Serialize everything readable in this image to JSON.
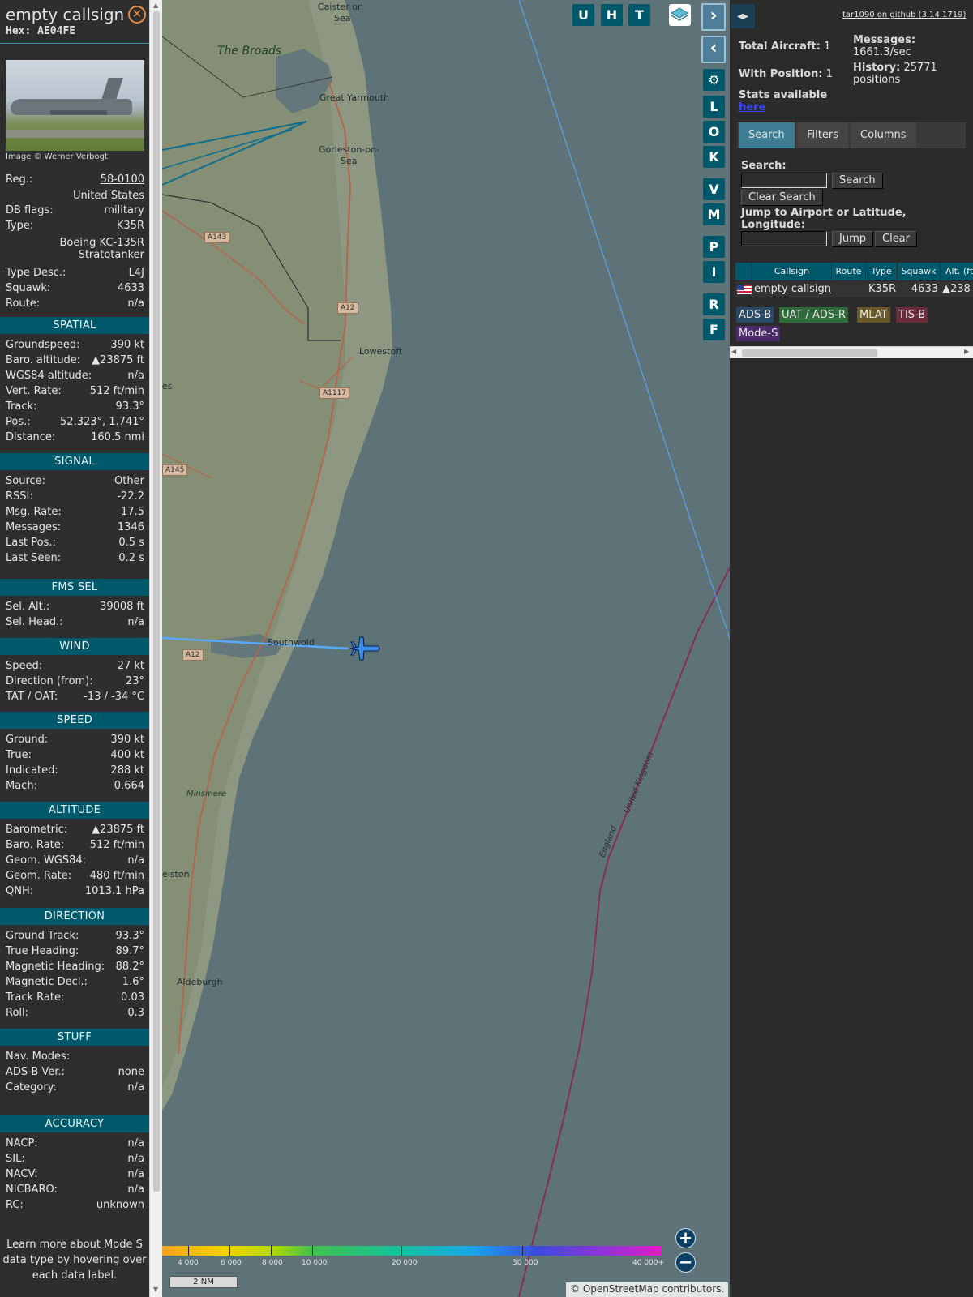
{
  "aircraft": {
    "callsign": "empty callsign",
    "hex_label": "Hex:",
    "hex": "AE04FE",
    "image_credit": "Image © Werner Verbogt",
    "reg_label": "Reg.:",
    "reg": "58-0100",
    "country": "United States",
    "db_flags_label": "DB flags:",
    "db_flags": "military",
    "type_label": "Type:",
    "type": "K35R",
    "type_full_1": "Boeing KC-135R",
    "type_full_2": "Stratotanker",
    "type_desc_label": "Type Desc.:",
    "type_desc": "L4J",
    "squawk_label": "Squawk:",
    "squawk": "4633",
    "route_label": "Route:",
    "route": "n/a"
  },
  "sections": {
    "spatial": "SPATIAL",
    "signal": "SIGNAL",
    "fms_sel": "FMS SEL",
    "wind": "WIND",
    "speed": "SPEED",
    "altitude": "ALTITUDE",
    "direction": "DIRECTION",
    "stuff": "STUFF",
    "accuracy": "ACCURACY"
  },
  "spatial": [
    {
      "k": "Groundspeed:",
      "v": "390 kt"
    },
    {
      "k": "Baro. altitude:",
      "v": "▲23875 ft"
    },
    {
      "k": "WGS84 altitude:",
      "v": "n/a"
    },
    {
      "k": "Vert. Rate:",
      "v": "512 ft/min"
    },
    {
      "k": "Track:",
      "v": "93.3°"
    },
    {
      "k": "Pos.:",
      "v": "52.323°, 1.741°"
    },
    {
      "k": "Distance:",
      "v": "160.5 nmi"
    }
  ],
  "signal": [
    {
      "k": "Source:",
      "v": "Other"
    },
    {
      "k": "RSSI:",
      "v": "-22.2"
    },
    {
      "k": "Msg. Rate:",
      "v": "17.5"
    },
    {
      "k": "Messages:",
      "v": "1346"
    },
    {
      "k": "Last Pos.:",
      "v": "0.5 s"
    },
    {
      "k": "Last Seen:",
      "v": "0.2 s"
    }
  ],
  "fms": [
    {
      "k": "Sel. Alt.:",
      "v": "39008 ft"
    },
    {
      "k": "Sel. Head.:",
      "v": "n/a"
    }
  ],
  "wind": [
    {
      "k": "Speed:",
      "v": "27 kt"
    },
    {
      "k": "Direction (from):",
      "v": "23°"
    },
    {
      "k": "TAT / OAT:",
      "v": "-13 / -34 °C"
    }
  ],
  "speed": [
    {
      "k": "Ground:",
      "v": "390 kt"
    },
    {
      "k": "True:",
      "v": "400 kt"
    },
    {
      "k": "Indicated:",
      "v": "288 kt"
    },
    {
      "k": "Mach:",
      "v": "0.664"
    }
  ],
  "altitude": [
    {
      "k": "Barometric:",
      "v": "▲23875 ft"
    },
    {
      "k": "Baro. Rate:",
      "v": "512 ft/min"
    },
    {
      "k": "Geom. WGS84:",
      "v": "n/a"
    },
    {
      "k": "Geom. Rate:",
      "v": "480 ft/min"
    },
    {
      "k": "QNH:",
      "v": "1013.1 hPa"
    }
  ],
  "direction": [
    {
      "k": "Ground Track:",
      "v": "93.3°"
    },
    {
      "k": "True Heading:",
      "v": "89.7°"
    },
    {
      "k": "Magnetic Heading:",
      "v": "88.2°"
    },
    {
      "k": "Magnetic Decl.:",
      "v": "1.6°"
    },
    {
      "k": "Track Rate:",
      "v": "0.03"
    },
    {
      "k": "Roll:",
      "v": "0.3"
    }
  ],
  "stuff": [
    {
      "k": "Nav. Modes:",
      "v": ""
    },
    {
      "k": "ADS-B Ver.:",
      "v": "none"
    },
    {
      "k": "Category:",
      "v": "n/a"
    }
  ],
  "accuracy": [
    {
      "k": "NACP:",
      "v": "n/a"
    },
    {
      "k": "SIL:",
      "v": "n/a"
    },
    {
      "k": "NACV:",
      "v": "n/a"
    },
    {
      "k": "NICBARO:",
      "v": "n/a"
    },
    {
      "k": "RC:",
      "v": "unknown"
    }
  ],
  "learn_more": "Learn more about Mode S data type by hovering over each data label.",
  "map": {
    "labels": [
      "Caister on Sea",
      "The Broads",
      "Great Yarmouth",
      "Gorleston-on-Sea",
      "Lowestoft",
      "Southwold",
      "Minsmere",
      "Aldeburgh",
      "eiston",
      "es",
      "United Kingdom",
      "England"
    ],
    "roads": [
      "A143",
      "A12",
      "A1117",
      "A145",
      "A12"
    ],
    "buttons": [
      "U",
      "H",
      "T",
      "L",
      "O",
      "K",
      "V",
      "M",
      "P",
      "I",
      "R",
      "F"
    ],
    "legend": [
      "4 000",
      "6 000",
      "8 000",
      "10 000",
      "20 000",
      "30 000",
      "40 000+"
    ],
    "scale": "2 NM",
    "attribution_prefix": "© ",
    "attribution_link": "OpenStreetMap",
    "attribution_suffix": " contributors.",
    "track_color": "#5aa9ff",
    "aircraft_color": "#3a8ef0"
  },
  "sidebar": {
    "github": "tar1090 on github (3.14.1719)",
    "total_aircraft_label": "Total Aircraft:",
    "total_aircraft": "1",
    "with_position_label": "With Position:",
    "with_position": "1",
    "messages_label": "Messages:",
    "messages": "1661.3/sec",
    "history_label": "History:",
    "history_value": "25771",
    "history_unit": "positions",
    "stats_label": "Stats available",
    "stats_link": "here",
    "tabs": [
      "Search",
      "Filters",
      "Columns"
    ],
    "search_label": "Search:",
    "search_button": "Search",
    "clear_search_button": "Clear Search",
    "jump_label": "Jump to Airport or Latitude, Longitude:",
    "jump_button": "Jump",
    "clear_button": "Clear",
    "table_headers": [
      "Callsign",
      "Route",
      "Type",
      "Squawk",
      "Alt. (ft)"
    ],
    "table_row": {
      "callsign": "empty callsign",
      "route": "",
      "type": "K35R",
      "squawk": "4633",
      "alt": "▲238"
    },
    "badges": [
      "ADS-B",
      "UAT / ADS-R",
      "MLAT",
      "TIS-B",
      "Mode-S"
    ]
  }
}
